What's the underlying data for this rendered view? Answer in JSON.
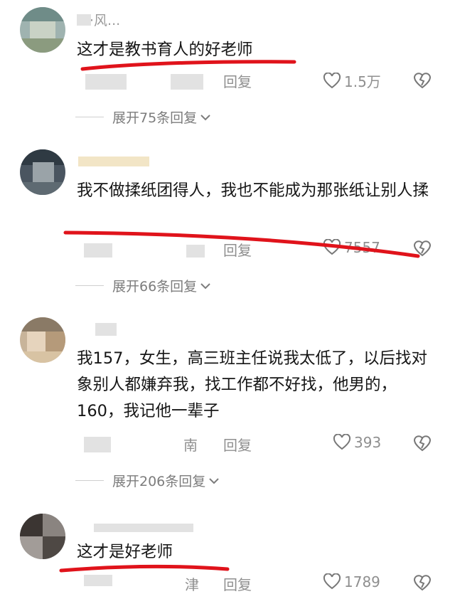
{
  "colors": {
    "text": "#161616",
    "muted": "#8f8f8f",
    "underline": "#e0131b"
  },
  "comments": [
    {
      "username": "·风...",
      "text": "这才是教书育人的好老师",
      "location": "",
      "reply": "回复",
      "likes": "1.5万",
      "expand": "展开75条回复",
      "expand_icon": "chevron-down-icon"
    },
    {
      "username": "",
      "text": "我不做揉纸团得人，我也不能成为那张纸让别人揉",
      "location": "",
      "reply": "回复",
      "likes": "7557",
      "expand": "展开66条回复",
      "expand_icon": "chevron-down-icon"
    },
    {
      "username": "",
      "text": "我157，女生，高三班主任说我太低了，以后找对象别人都嫌弃我，找工作都不好找，他男的，160，我记他一辈子",
      "location": "南",
      "reply": "回复",
      "likes": "393",
      "expand": "展开206条回复",
      "expand_icon": "chevron-down-icon"
    },
    {
      "username": "",
      "text": "这才是好老师",
      "location": "津",
      "reply": "回复",
      "likes": "1789",
      "expand": "",
      "expand_icon": ""
    }
  ]
}
